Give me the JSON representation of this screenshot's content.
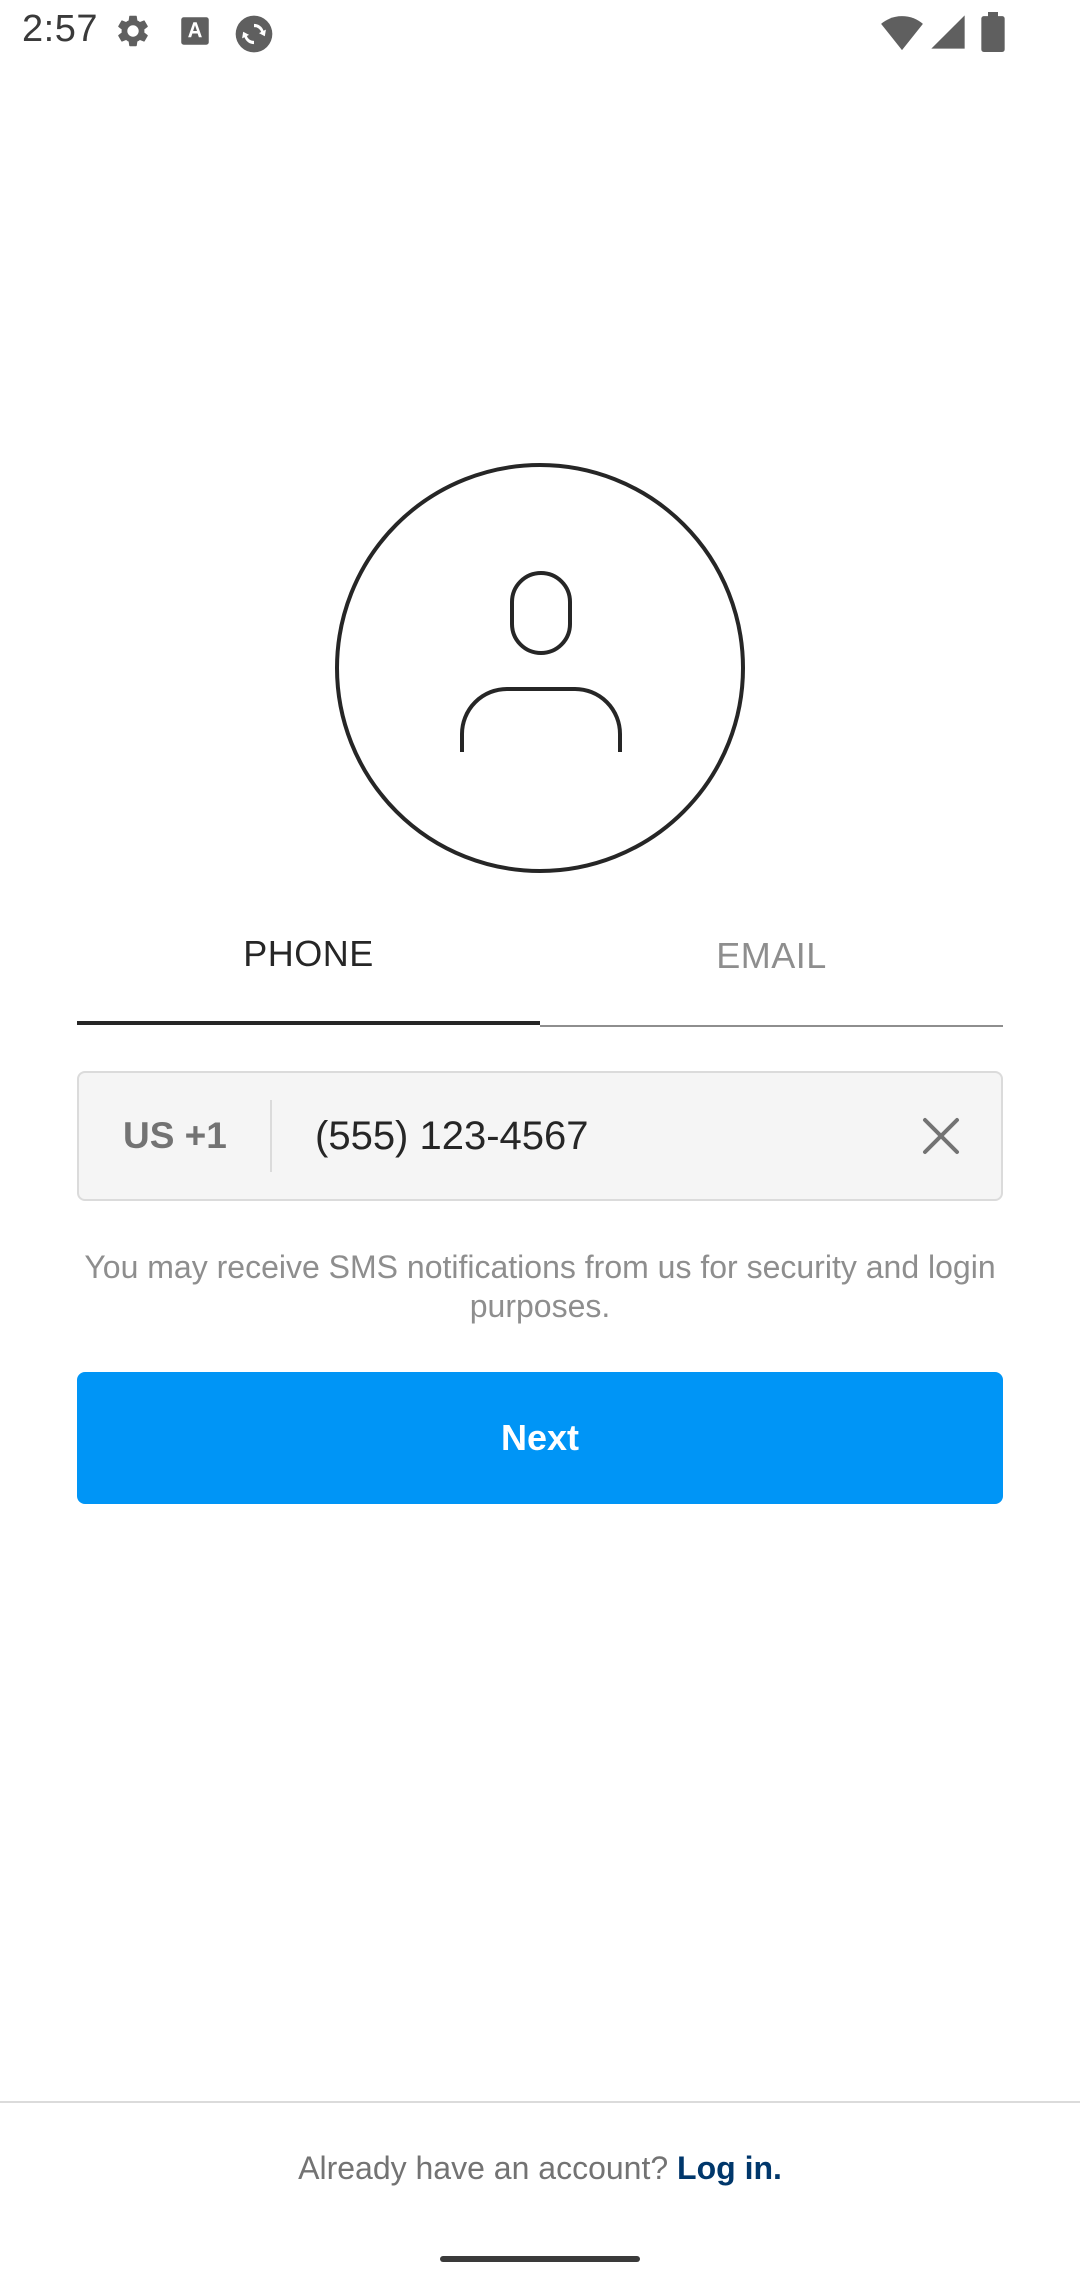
{
  "status_bar": {
    "time": "2:57",
    "icons": [
      "gear-icon",
      "font-icon",
      "sync-icon",
      "wifi-icon",
      "signal-icon",
      "battery-icon"
    ]
  },
  "tabs": [
    {
      "label": "PHONE",
      "active": true
    },
    {
      "label": "EMAIL",
      "active": false
    }
  ],
  "phone_input": {
    "country_code": "US +1",
    "value": "(555) 123-4567"
  },
  "notice": "You may receive SMS notifications from us for security and login purposes.",
  "next_button": {
    "label": "Next"
  },
  "footer": {
    "text": "Already have an account?",
    "link": "Log in."
  },
  "colors": {
    "primary": "#0095f6",
    "link": "#00376b",
    "muted_text": "#8e8e8e",
    "field_background": "#f5f5f5",
    "border": "#dbdbdb"
  }
}
